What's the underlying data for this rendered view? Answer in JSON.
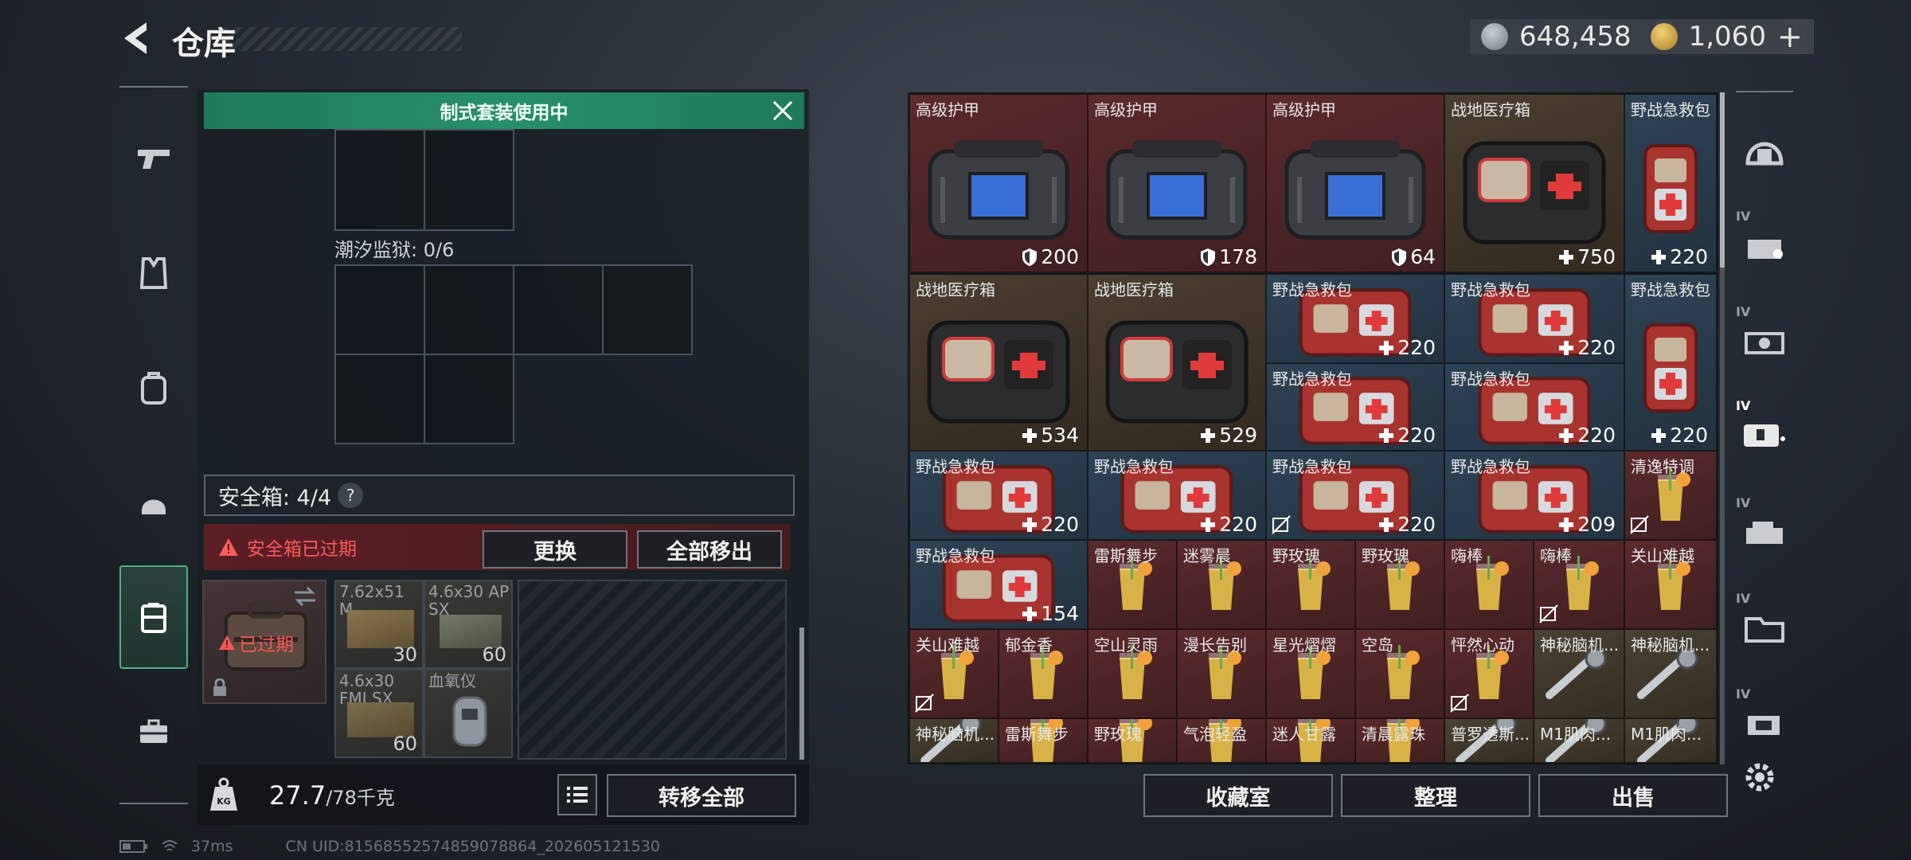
{
  "header": {
    "title": "仓库"
  },
  "currency": {
    "silver": "648,458",
    "gold": "1,060",
    "add_label": "+"
  },
  "left_nav": {
    "items": [
      "weapon",
      "armor",
      "backpack",
      "helmet",
      "safe-box",
      "briefcase"
    ],
    "active": "safe-box"
  },
  "banner": {
    "text": "制式套装使用中"
  },
  "tide_prison": {
    "label": "潮汐监狱: 0/6"
  },
  "safe_box": {
    "label": "安全箱: 4/4",
    "help": "?",
    "expired_text": "安全箱已过期",
    "replace_label": "更换",
    "move_all_label": "全部移出",
    "case_status": "已过期",
    "items": [
      {
        "name": "7.62x51 M...",
        "count": "30"
      },
      {
        "name": "4.6x30 AP SX",
        "count": "60"
      },
      {
        "name": "4.6x30 FMJ SX",
        "count": "60"
      },
      {
        "name": "血氧仪",
        "count": ""
      }
    ]
  },
  "weight": {
    "current": "27.7",
    "max": "/78千克"
  },
  "transfer_all_label": "转移全部",
  "bottom_buttons": {
    "collection": "收藏室",
    "sort": "整理",
    "sell": "出售"
  },
  "grid": {
    "rows": [
      [
        {
          "name": "高级护甲",
          "value": "200",
          "icon": "shield",
          "kind": "armor"
        },
        {
          "name": "高级护甲",
          "value": "178",
          "icon": "shield",
          "kind": "armor"
        },
        {
          "name": "高级护甲",
          "value": "64",
          "icon": "shield",
          "kind": "armor"
        },
        {
          "name": "战地医疗箱",
          "value": "750",
          "icon": "plus",
          "kind": "medbox"
        },
        {
          "name": "野战急救包",
          "value": "220",
          "icon": "plus",
          "kind": "medtall"
        }
      ],
      [
        {
          "name": "战地医疗箱",
          "value": "534",
          "icon": "plus",
          "kind": "medbox"
        },
        {
          "name": "战地医疗箱",
          "value": "529",
          "icon": "plus",
          "kind": "medbox"
        },
        {
          "name": "野战急救包",
          "value": "220",
          "icon": "plus",
          "kind": "medkit"
        },
        {
          "name": "野战急救包",
          "value": "220",
          "icon": "plus",
          "kind": "medkit"
        },
        {
          "name": "野战急救包",
          "value": "220",
          "icon": "plus",
          "kind": "medtall"
        },
        {
          "name": "野战急救包",
          "value": "220",
          "icon": "plus",
          "kind": "medkit"
        },
        {
          "name": "野战急救包",
          "value": "220",
          "icon": "plus",
          "kind": "medkit"
        }
      ],
      [
        {
          "name": "野战急救包",
          "value": "220",
          "icon": "plus",
          "kind": "medkit"
        },
        {
          "name": "野战急救包",
          "value": "220",
          "icon": "plus",
          "kind": "medkit"
        },
        {
          "name": "野战急救包",
          "value": "220",
          "icon": "plus",
          "kind": "medkit"
        },
        {
          "name": "野战急救包",
          "value": "209",
          "icon": "plus",
          "kind": "medkit"
        },
        {
          "name": "清逸特调",
          "value": "",
          "icon": "",
          "kind": "drink"
        }
      ],
      [
        {
          "name": "野战急救包",
          "value": "154",
          "icon": "plus",
          "kind": "medkit"
        },
        {
          "name": "雷斯舞步",
          "kind": "drink"
        },
        {
          "name": "迷雾晨",
          "kind": "drink"
        },
        {
          "name": "野玫瑰",
          "kind": "drink"
        },
        {
          "name": "野玫瑰",
          "kind": "drink"
        },
        {
          "name": "嗨棒",
          "kind": "drink"
        },
        {
          "name": "嗨棒",
          "kind": "drink"
        },
        {
          "name": "关山难越",
          "kind": "drink"
        }
      ],
      [
        {
          "name": "关山难越",
          "kind": "drink"
        },
        {
          "name": "郁金香",
          "kind": "drink"
        },
        {
          "name": "空山灵雨",
          "kind": "drink"
        },
        {
          "name": "漫长告别",
          "kind": "drink"
        },
        {
          "name": "星光熠熠",
          "kind": "drink"
        },
        {
          "name": "空岛",
          "kind": "drink"
        },
        {
          "name": "怦然心动",
          "kind": "drink"
        },
        {
          "name": "神秘脑机...",
          "kind": "device"
        },
        {
          "name": "神秘脑机...",
          "kind": "device"
        }
      ],
      [
        {
          "name": "神秘脑机...",
          "kind": "device"
        },
        {
          "name": "雷斯舞步",
          "kind": "drink"
        },
        {
          "name": "野玫瑰",
          "kind": "drink"
        },
        {
          "name": "气泡轻盈",
          "kind": "drink"
        },
        {
          "name": "迷人甘露",
          "kind": "drink"
        },
        {
          "name": "清晨露珠",
          "kind": "drink"
        },
        {
          "name": "普罗透斯...",
          "kind": "device"
        },
        {
          "name": "M1肌肉...",
          "kind": "device"
        },
        {
          "name": "M1肌肉...",
          "kind": "device"
        }
      ]
    ]
  },
  "right_nav": {
    "items": [
      "helmet-slot",
      "armor-slot-IV",
      "weapon-slot-IV",
      "medical-slot-IV",
      "vehicle-slot-IV",
      "folder-slot-IV",
      "misc-slot-IV"
    ],
    "tier_label": "IV"
  },
  "status_bar": {
    "ping": "37ms",
    "uid": "CN UID:8156855257485907886​4_202605121530"
  }
}
